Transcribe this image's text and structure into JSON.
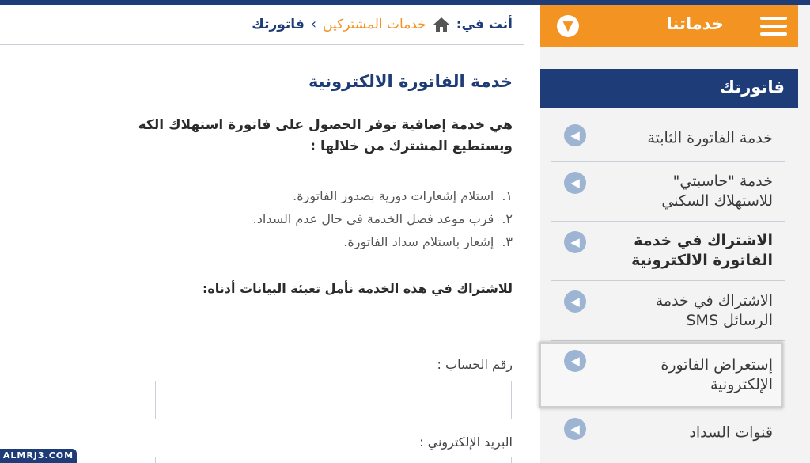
{
  "colors": {
    "accent": "#f39322",
    "navy": "#1d3c78",
    "sidebar_bg": "#f3f3f3",
    "arrow": "#9db4d3"
  },
  "sidebar": {
    "services_label": "خدماتنا",
    "menu_icon": "hamburger-menu-icon",
    "toggle_icon": "chevron-down-circle-icon",
    "section_title": "فاتورتك",
    "items": [
      {
        "label": "خدمة الفاتورة الثابتة",
        "icon": "arrow-left-circle-icon"
      },
      {
        "label": "خدمة \"حاسبتي\"\nللاستهلاك السكني",
        "icon": "arrow-left-circle-icon"
      },
      {
        "label": "الاشتراك في خدمة\nالفاتورة الالكترونية",
        "icon": "arrow-left-circle-icon",
        "active": true
      },
      {
        "label": "الاشتراك في خدمة\nالرسائل SMS",
        "icon": "arrow-left-circle-icon"
      },
      {
        "label": "إستعراض الفاتورة\nالإلكترونية",
        "icon": "arrow-left-circle-icon",
        "highlighted": true
      },
      {
        "label": "قنوات السداد",
        "icon": "arrow-left-circle-icon"
      }
    ]
  },
  "breadcrumb": {
    "prefix": "أنت في:",
    "home_icon": "home-icon",
    "link": "خدمات المشتركين",
    "separator": "›",
    "current": "فاتورتك"
  },
  "main": {
    "title": "خدمة الفاتورة الالكترونية",
    "intro_line1": "هي خدمة إضافية توفر الحصول على فاتورة استهلاك الكه",
    "intro_line2": "ويستطيع المشترك من خلالها :",
    "features": [
      {
        "num": "١.",
        "text": "استلام إشعارات دورية بصدور الفاتورة."
      },
      {
        "num": "٢.",
        "text": "قرب موعد فصل الخدمة في حال عدم السداد."
      },
      {
        "num": "٣.",
        "text": "إشعار باستلام سداد الفاتورة."
      }
    ],
    "subscribe_note": "للاشتراك في هذه الخدمة   نأمل تعبئة البيانات أدناه:",
    "account_label": "رقم الحساب :",
    "account_value": "",
    "email_label": "البريد الإلكتروني :",
    "email_value": ""
  },
  "watermark": "ALMRJ3.COM"
}
